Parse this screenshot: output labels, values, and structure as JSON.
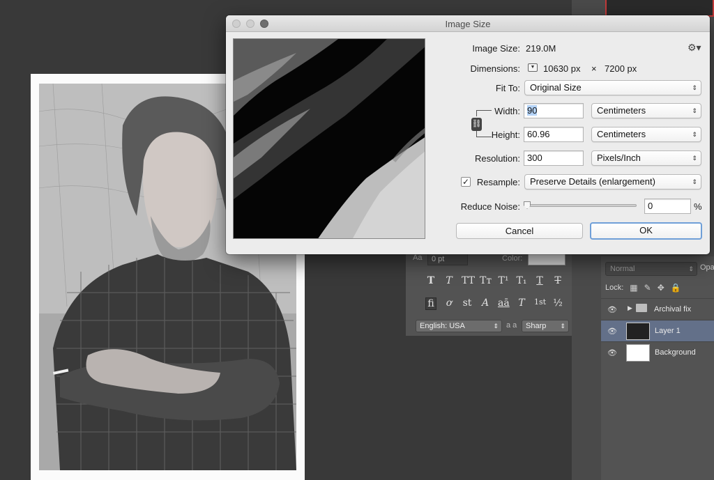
{
  "dialog": {
    "title": "Image Size",
    "image_size_label": "Image Size:",
    "image_size_value": "219.0M",
    "dimensions_label": "Dimensions:",
    "dimensions_width": "10630 px",
    "dimensions_x": "×",
    "dimensions_height": "7200 px",
    "fit_to_label": "Fit To:",
    "fit_to_value": "Original Size",
    "width_label": "Width:",
    "width_value": "90",
    "width_unit": "Centimeters",
    "height_label": "Height:",
    "height_value": "60.96",
    "height_unit": "Centimeters",
    "resolution_label": "Resolution:",
    "resolution_value": "300",
    "resolution_unit": "Pixels/Inch",
    "resample_label": "Resample:",
    "resample_checked": true,
    "resample_value": "Preserve Details (enlargement)",
    "reduce_noise_label": "Reduce Noise:",
    "reduce_noise_value": "0",
    "reduce_noise_unit": "%",
    "cancel_label": "Cancel",
    "ok_label": "OK",
    "icons": [
      "gear-icon",
      "chain-link-icon",
      "disclosure-triangle-icon"
    ]
  },
  "character_panel": {
    "tracking_value": "0 pt",
    "color_label": "Color:",
    "style_glyphs": [
      "T",
      "T",
      "TT",
      "Tт",
      "T¹",
      "T₁",
      "T",
      "T"
    ],
    "opentype_glyphs": [
      "fi",
      "ơ",
      "st",
      "A",
      "aā",
      "T",
      "1st",
      "½"
    ],
    "language_value": "English: USA",
    "aa_label": "a a",
    "antialias_value": "Sharp"
  },
  "layers_panel": {
    "blend_mode": "Normal",
    "opacity_label": "Opa",
    "lock_label": "Lock:",
    "layers": [
      {
        "name": "Archival fix",
        "type": "group",
        "selected": false
      },
      {
        "name": "Layer 1",
        "type": "image",
        "selected": true
      },
      {
        "name": "Background",
        "type": "fill",
        "selected": false
      }
    ]
  },
  "colors": {
    "selected_layer": "#637089",
    "default_button_ring": "#6f9fd8"
  }
}
